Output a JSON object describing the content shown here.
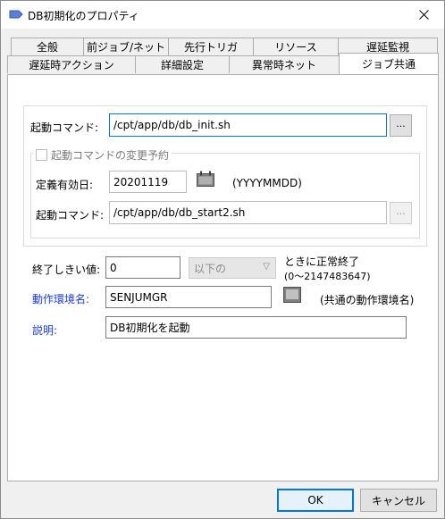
{
  "window": {
    "title": "DB初期化のプロパティ"
  },
  "tabs": {
    "row_back": [
      "全般",
      "前ジョブ/ネット",
      "先行トリガ",
      "リソース",
      "遅延監視"
    ],
    "row_front": [
      "遅延時アクション",
      "詳細設定",
      "異常時ネット",
      "ジョブ共通"
    ],
    "selected": "ジョブ共通"
  },
  "form": {
    "start_command_label": "起動コマンド:",
    "start_command_value": "/cpt/app/db/db_init.sh",
    "browse_label": "...",
    "reservation_checkbox_label": "起動コマンドの変更予約",
    "reservation_checked": false,
    "effective_date_label": "定義有効日:",
    "effective_date_value": "20201119",
    "date_format_hint": "(YYYYMMDD)",
    "start_command2_label": "起動コマンド:",
    "start_command2_value": "/cpt/app/db/db_start2.sh",
    "threshold_label": "終了しきい値:",
    "threshold_value": "0",
    "threshold_compare": "以下の",
    "threshold_note_line1": "ときに正常終了",
    "threshold_note_line2": "(0〜2147483647)",
    "env_label": "動作環境名:",
    "env_value": "SENJUMGR",
    "env_hint": "(共通の動作環境名)",
    "description_label": "説明:",
    "description_value": "DB初期化を起動"
  },
  "footer": {
    "ok_label": "OK",
    "cancel_label": "キャンセル"
  },
  "colors": {
    "link_label": "#1a3cd8",
    "focus_border": "#0078d7"
  }
}
